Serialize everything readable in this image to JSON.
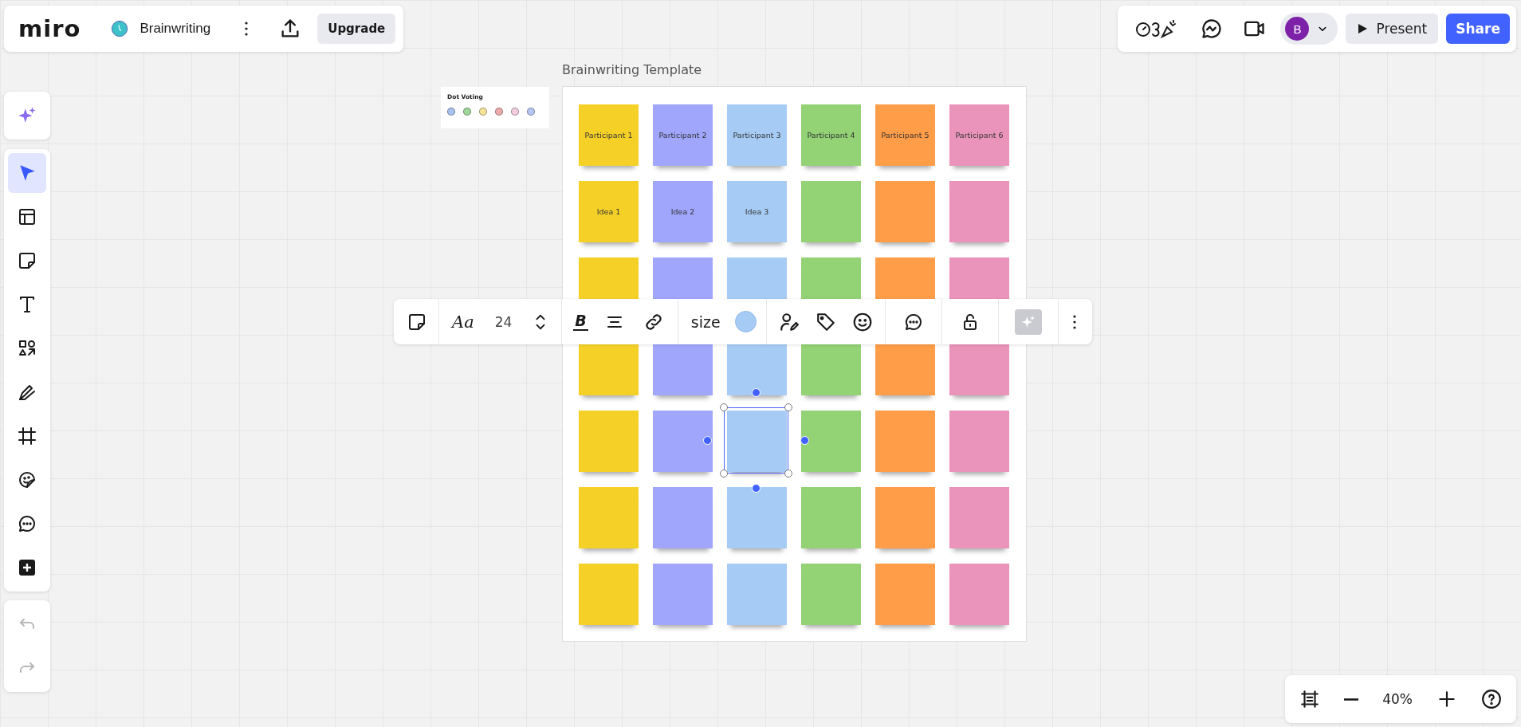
{
  "top_bar": {
    "logo": "miro",
    "board_name": "Brainwriting",
    "upgrade": "Upgrade"
  },
  "top_right": {
    "avatar": "B",
    "present": "Present",
    "share": "Share"
  },
  "tools": [
    {
      "kind": "select",
      "selected": true
    },
    {
      "kind": "templates",
      "selected": false
    },
    {
      "kind": "sticky",
      "selected": false
    },
    {
      "kind": "text",
      "selected": false
    },
    {
      "kind": "shapes",
      "selected": false
    },
    {
      "kind": "pen",
      "selected": false
    },
    {
      "kind": "frame",
      "selected": false
    },
    {
      "kind": "sticker",
      "selected": false
    },
    {
      "kind": "comment",
      "selected": false
    },
    {
      "kind": "more",
      "selected": false
    }
  ],
  "history": [
    {
      "kind": "undo",
      "disabled": true
    },
    {
      "kind": "redo",
      "disabled": true
    }
  ],
  "dot_voting": {
    "title": "Dot Voting",
    "dots": [
      {
        "color": "#a9c3f2"
      },
      {
        "color": "#9fd79a"
      },
      {
        "color": "#f7e29a"
      },
      {
        "color": "#ecaaaa"
      },
      {
        "color": "#f3cce0"
      },
      {
        "color": "#b6c6f5"
      }
    ]
  },
  "frame": {
    "title": "Brainwriting Template",
    "rows": [
      [
        {
          "text": "Participant 1",
          "color": "#f5d128",
          "selected": false
        },
        {
          "text": "Participant 2",
          "color": "#a0a6fb",
          "selected": false
        },
        {
          "text": "Participant 3",
          "color": "#a6ccf5",
          "selected": false
        },
        {
          "text": "Participant 4",
          "color": "#93d275",
          "selected": false
        },
        {
          "text": "Participant 5",
          "color": "#ff9d48",
          "selected": false
        },
        {
          "text": "Participant 6",
          "color": "#ea94bb",
          "selected": false
        }
      ],
      [
        {
          "text": "Idea 1",
          "color": "#f5d128",
          "selected": false
        },
        {
          "text": "Idea 2",
          "color": "#a0a6fb",
          "selected": false
        },
        {
          "text": "Idea 3",
          "color": "#a6ccf5",
          "selected": false
        },
        {
          "color": "#93d275",
          "selected": false
        },
        {
          "color": "#ff9d48",
          "selected": false
        },
        {
          "color": "#ea94bb",
          "selected": false
        }
      ],
      [
        {
          "color": "#f5d128",
          "selected": false
        },
        {
          "color": "#a0a6fb",
          "selected": false
        },
        {
          "color": "#a6ccf5",
          "selected": false
        },
        {
          "color": "#93d275",
          "selected": false
        },
        {
          "color": "#ff9d48",
          "selected": false
        },
        {
          "color": "#ea94bb",
          "selected": false
        }
      ],
      [
        {
          "color": "#f5d128",
          "selected": false
        },
        {
          "color": "#a0a6fb",
          "selected": false
        },
        {
          "color": "#a6ccf5",
          "selected": false
        },
        {
          "color": "#93d275",
          "selected": false
        },
        {
          "color": "#ff9d48",
          "selected": false
        },
        {
          "color": "#ea94bb",
          "selected": false
        }
      ],
      [
        {
          "color": "#f5d128",
          "selected": false
        },
        {
          "color": "#a0a6fb",
          "selected": false
        },
        {
          "color": "#a6ccf5",
          "selected": true
        },
        {
          "color": "#93d275",
          "selected": false
        },
        {
          "color": "#ff9d48",
          "selected": false
        },
        {
          "color": "#ea94bb",
          "selected": false
        }
      ],
      [
        {
          "color": "#f5d128",
          "selected": false
        },
        {
          "color": "#a0a6fb",
          "selected": false
        },
        {
          "color": "#a6ccf5",
          "selected": false
        },
        {
          "color": "#93d275",
          "selected": false
        },
        {
          "color": "#ff9d48",
          "selected": false
        },
        {
          "color": "#ea94bb",
          "selected": false
        }
      ],
      [
        {
          "color": "#f5d128",
          "selected": false
        },
        {
          "color": "#a0a6fb",
          "selected": false
        },
        {
          "color": "#a6ccf5",
          "selected": false
        },
        {
          "color": "#93d275",
          "selected": false
        },
        {
          "color": "#ff9d48",
          "selected": false
        },
        {
          "color": "#ea94bb",
          "selected": false
        }
      ]
    ]
  },
  "context_toolbar": {
    "font_glyph": "Aa",
    "font_size": "24",
    "bold_glyph": "B",
    "size_label": "size"
  },
  "zoom": {
    "level_text": "40%"
  }
}
